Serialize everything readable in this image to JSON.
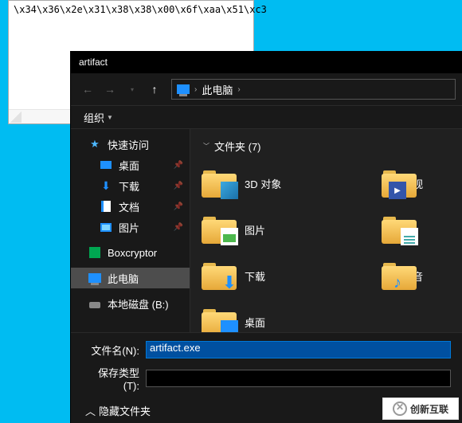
{
  "textwin": {
    "content": "\\x34\\x36\\x2e\\x31\\x38\\x38\\x00\\x6f\\xaa\\x51\\xc3"
  },
  "dialog": {
    "title": "artifact",
    "breadcrumb": {
      "root": "此电脑"
    },
    "toolbar": {
      "org": "组织"
    },
    "sidebar": {
      "quick": "快速访问",
      "desktop": "桌面",
      "downloads": "下载",
      "documents": "文档",
      "pictures": "图片",
      "boxcryptor": "Boxcryptor",
      "thispc": "此电脑",
      "localdisk": "本地磁盘 (B:)"
    },
    "content": {
      "group": "文件夹 (7)",
      "items": {
        "obj3d": "3D 对象",
        "pictures": "图片",
        "downloads": "下载",
        "desktop": "桌面",
        "videos": "视",
        "music": "音"
      }
    },
    "fields": {
      "name_label": "文件名(N):",
      "name_value": "artifact.exe",
      "type_label": "保存类型(T):"
    },
    "hidden": "隐藏文件夹"
  },
  "watermark": "创新互联"
}
